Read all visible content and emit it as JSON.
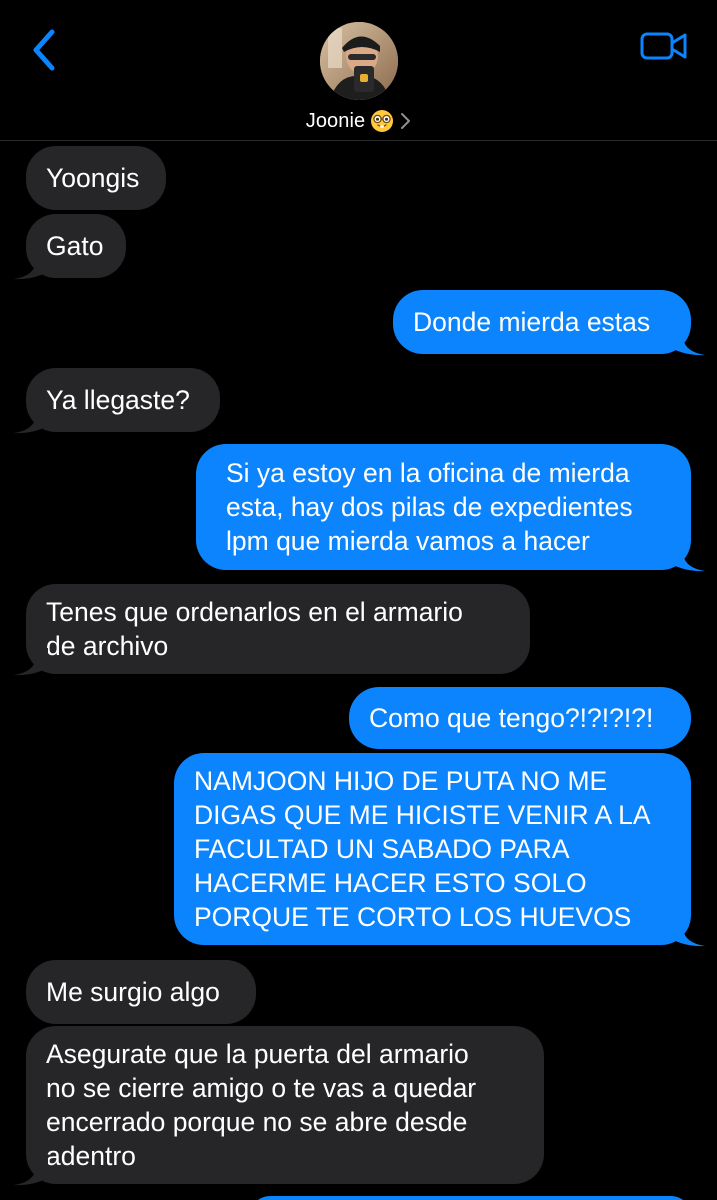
{
  "header": {
    "contact_name": "Joonie",
    "contact_emoji": "nerd-face-emoji",
    "back_icon": "chevron-left-icon",
    "video_icon": "video-camera-icon",
    "accent_color": "#0b84fe"
  },
  "messages": [
    {
      "direction": "incoming",
      "text": "Yoongis"
    },
    {
      "direction": "incoming",
      "text": "Gato"
    },
    {
      "direction": "outgoing",
      "text": "Donde mierda estas"
    },
    {
      "direction": "incoming",
      "text": "Ya llegaste?"
    },
    {
      "direction": "outgoing",
      "text": "Si ya estoy en la oficina de mierda\nesta, hay dos pilas de expedientes\nlpm que mierda vamos a hacer"
    },
    {
      "direction": "incoming",
      "text": "Tenes que ordenarlos en el armario\nde archivo"
    },
    {
      "direction": "outgoing",
      "text": "Como que tengo?!?!?!?!"
    },
    {
      "direction": "outgoing",
      "text": "NAMJOON HIJO DE PUTA NO ME\nDIGAS QUE ME HICISTE VENIR A LA\nFACULTAD UN SABADO PARA\nHACERME HACER ESTO SOLO\nPORQUE TE CORTO LOS HUEVOS"
    },
    {
      "direction": "incoming",
      "text": "Me surgio algo"
    },
    {
      "direction": "incoming",
      "text": "Asegurate que la puerta del armario\nno se cierre amigo o te vas a quedar\nencerrado porque no se abre desde\nadentro"
    }
  ],
  "colors": {
    "incoming_bubble": "#262628",
    "outgoing_bubble": "#0b84fe",
    "background": "#000000"
  }
}
